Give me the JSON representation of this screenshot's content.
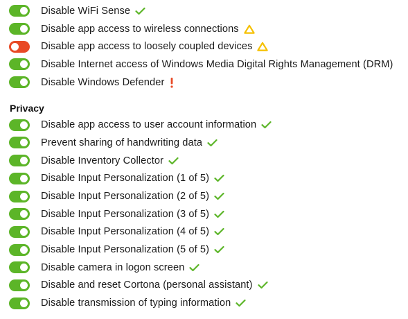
{
  "colors": {
    "toggle_on": "#5cb528",
    "toggle_off": "#e84a26",
    "check": "#5cb528",
    "warning": "#f5c000",
    "critical": "#e84a26"
  },
  "top_items": [
    {
      "label": "Disable WiFi Sense",
      "state": "on",
      "status_icon": "check-icon"
    },
    {
      "label": "Disable app access to wireless connections",
      "state": "on",
      "status_icon": "warning-icon"
    },
    {
      "label": "Disable app access to loosely coupled devices",
      "state": "off",
      "status_icon": "warning-icon"
    },
    {
      "label": "Disable Internet access of Windows Media Digital Rights Management (DRM)",
      "state": "on",
      "status_icon": "none"
    },
    {
      "label": "Disable Windows Defender",
      "state": "on",
      "status_icon": "exclamation-icon"
    }
  ],
  "privacy": {
    "header": "Privacy",
    "items": [
      {
        "label": "Disable app access to user account information",
        "state": "on",
        "status_icon": "check-icon"
      },
      {
        "label": "Prevent sharing of handwriting data",
        "state": "on",
        "status_icon": "check-icon"
      },
      {
        "label": "Disable Inventory Collector",
        "state": "on",
        "status_icon": "check-icon"
      },
      {
        "label": "Disable Input Personalization (1 of 5)",
        "state": "on",
        "status_icon": "check-icon"
      },
      {
        "label": "Disable Input Personalization (2 of 5)",
        "state": "on",
        "status_icon": "check-icon"
      },
      {
        "label": "Disable Input Personalization (3 of 5)",
        "state": "on",
        "status_icon": "check-icon"
      },
      {
        "label": "Disable Input Personalization (4 of 5)",
        "state": "on",
        "status_icon": "check-icon"
      },
      {
        "label": "Disable Input Personalization (5 of 5)",
        "state": "on",
        "status_icon": "check-icon"
      },
      {
        "label": "Disable camera in logon screen",
        "state": "on",
        "status_icon": "check-icon"
      },
      {
        "label": "Disable and reset Cortona (personal assistant)",
        "state": "on",
        "status_icon": "check-icon"
      },
      {
        "label": "Disable transmission of typing information",
        "state": "on",
        "status_icon": "check-icon"
      }
    ]
  }
}
